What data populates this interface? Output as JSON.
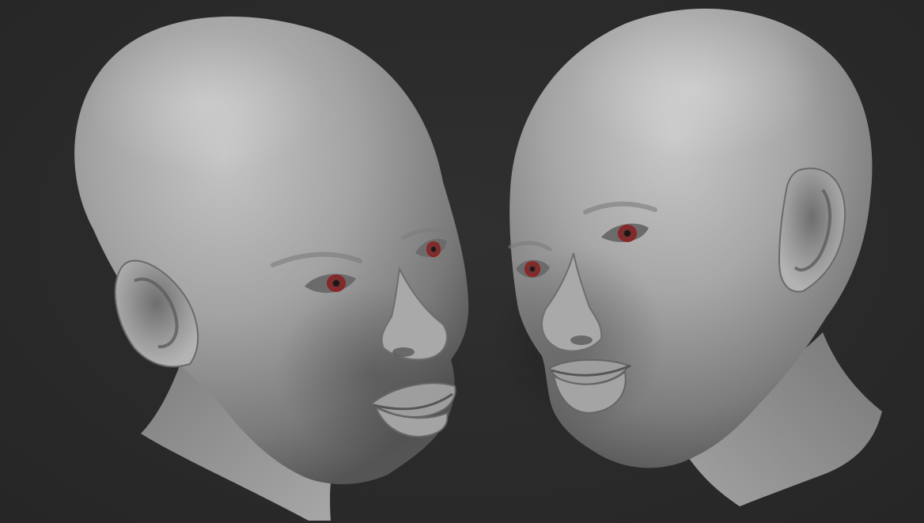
{
  "scene": {
    "background_color": "#2b2b2b",
    "clay_color": "#9a9a9a",
    "eye_tint": "#8a1a1a",
    "subjects": [
      {
        "name": "sculpt-head-left",
        "facing": "right"
      },
      {
        "name": "sculpt-head-right",
        "facing": "left"
      }
    ]
  }
}
